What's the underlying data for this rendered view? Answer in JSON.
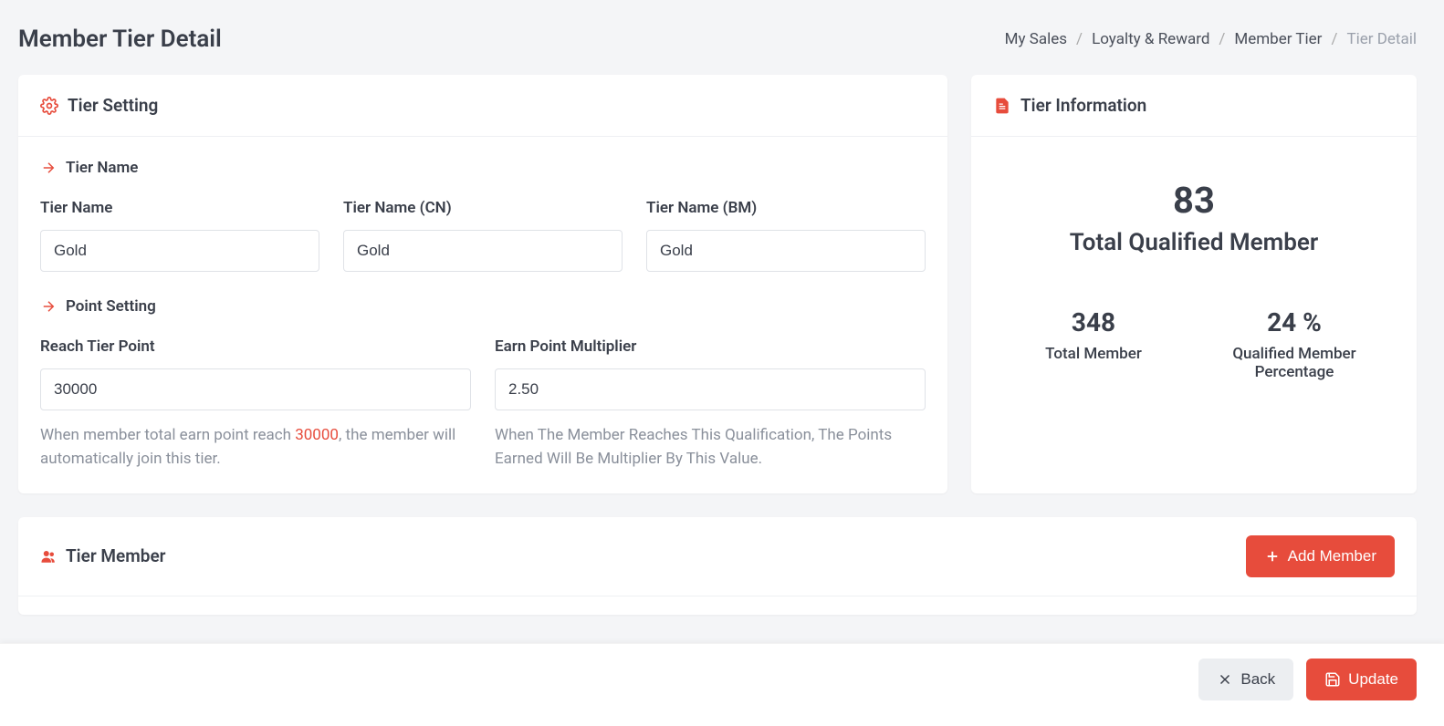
{
  "page_title": "Member Tier Detail",
  "breadcrumb": [
    "My Sales",
    "Loyalty & Reward",
    "Member Tier",
    "Tier Detail"
  ],
  "tier_setting": {
    "title": "Tier Setting",
    "section_name": "Tier Name",
    "tier_name_label": "Tier Name",
    "tier_name": "Gold",
    "tier_name_cn_label": "Tier Name (CN)",
    "tier_name_cn": "Gold",
    "tier_name_bm_label": "Tier Name (BM)",
    "tier_name_bm": "Gold",
    "section_point": "Point Setting",
    "reach_point_label": "Reach Tier Point",
    "reach_point": "30000",
    "reach_helper_pre": "When member total earn point reach ",
    "reach_helper_value": "30000",
    "reach_helper_post": ", the member will automatically join this tier.",
    "mult_label": "Earn Point Multiplier",
    "mult": "2.50",
    "mult_helper": "When The Member Reaches This Qualification, The Points Earned Will Be Multiplier By This Value."
  },
  "tier_info": {
    "title": "Tier Information",
    "qualified_count": "83",
    "qualified_label": "Total Qualified Member",
    "total_member": "348",
    "total_member_label": "Total Member",
    "percent": "24 %",
    "percent_label": "Qualified Member Percentage"
  },
  "tier_member": {
    "title": "Tier Member",
    "add_label": "Add Member"
  },
  "footer": {
    "back": "Back",
    "update": "Update"
  }
}
